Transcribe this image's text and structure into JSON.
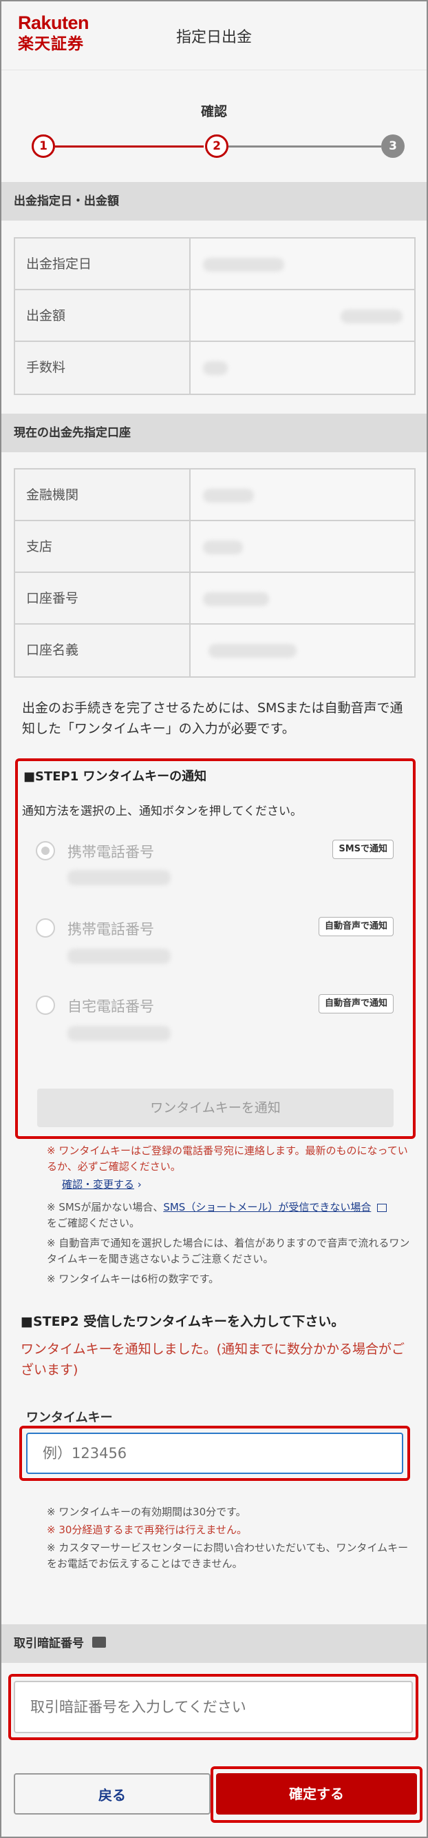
{
  "header": {
    "logo_en": "Rakuten",
    "logo_ja": "楽天証券",
    "title": "指定日出金"
  },
  "steps": {
    "current_title": "確認",
    "items": [
      "1",
      "2",
      "3"
    ],
    "accent_color": "#bf0000"
  },
  "withdrawal": {
    "section_title": "出金指定日・出金額",
    "rows": [
      {
        "label": "出金指定日"
      },
      {
        "label": "出金額"
      },
      {
        "label": "手数料"
      }
    ]
  },
  "account": {
    "section_title": "現在の出金先指定口座",
    "rows": [
      {
        "label": "金融機関"
      },
      {
        "label": "支店"
      },
      {
        "label": "口座番号"
      },
      {
        "label": "口座名義"
      }
    ]
  },
  "notice": "出金のお手続きを完了させるためには、SMSまたは自動音声で通知した「ワンタイムキー」の入力が必要です。",
  "step1": {
    "title": "■STEP1 ワンタイムキーの通知",
    "instruction": "通知方法を選択の上、通知ボタンを押してください。",
    "options": [
      {
        "label": "携帯電話番号",
        "button": "SMSで通知",
        "checked": true
      },
      {
        "label": "携帯電話番号",
        "button": "自動音声で通知",
        "checked": false
      },
      {
        "label": "自宅電話番号",
        "button": "自動音声で通知",
        "checked": false
      }
    ],
    "notify_button": "ワンタイムキーを通知"
  },
  "notes1": {
    "n1": "※ ワンタイムキーはご登録の電話番号宛に連絡します。最新のものになっているか、必ずご確認ください。",
    "n1_link": "確認・変更する",
    "n2_prefix": "※ SMSが届かない場合、",
    "n2_link": "SMS（ショートメール）が受信できない場合",
    "n2_suffix": "をご確認ください。",
    "n3": "※ 自動音声で通知を選択した場合には、着信がありますので音声で流れるワンタイムキーを聞き逃さないようご注意ください。",
    "n4": "※ ワンタイムキーは6桁の数字です。"
  },
  "step2": {
    "title": "■STEP2 受信したワンタイムキーを入力して下さい。",
    "message": "ワンタイムキーを通知しました。(通知までに数分かかる場合がございます)",
    "field_label": "ワンタイムキー",
    "placeholder": "例）123456"
  },
  "notes2": {
    "n1": "※ ワンタイムキーの有効期間は30分です。",
    "n2": "※ 30分経過するまで再発行は行えません。",
    "n3": "※ カスタマーサービスセンターにお問い合わせいただいても、ワンタイムキーをお電話でお伝えすることはできません。"
  },
  "pin": {
    "section_title": "取引暗証番号",
    "placeholder": "取引暗証番号を入力してください"
  },
  "buttons": {
    "back": "戻る",
    "confirm": "確定する"
  }
}
